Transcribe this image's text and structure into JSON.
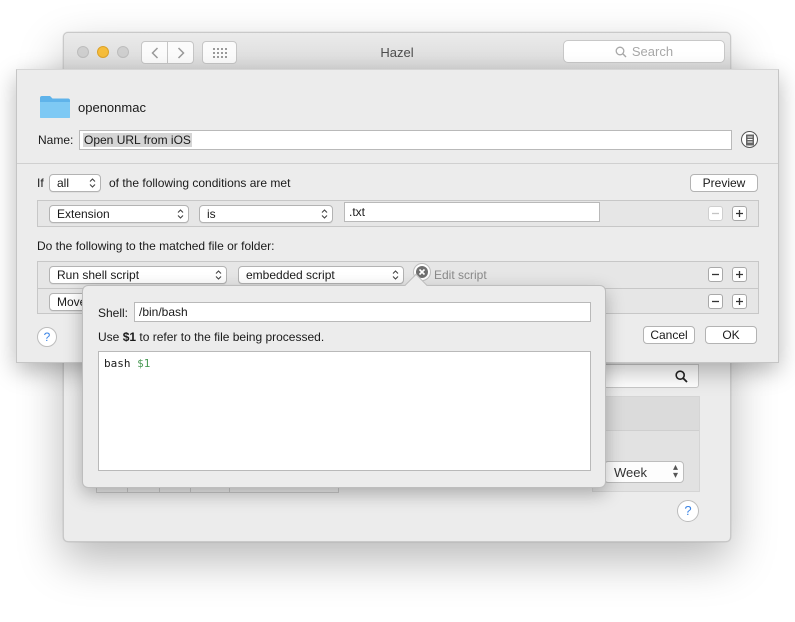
{
  "window": {
    "title": "Hazel",
    "search_placeholder": "Search",
    "week_select": "Week",
    "help": "?"
  },
  "sheet": {
    "folder_name": "openonmac",
    "name_label": "Name:",
    "name_value": "Open URL from iOS",
    "conditions": {
      "if_label": "If",
      "match_select": "all",
      "suffix": "of the following conditions are met",
      "preview_button": "Preview",
      "rule": {
        "attribute": "Extension",
        "operator": "is",
        "value": ".txt"
      }
    },
    "actions": {
      "heading": "Do the following to the matched file or folder:",
      "items": [
        {
          "action": "Run shell script",
          "option": "embedded script",
          "edit_link": "Edit script"
        },
        {
          "action": "Move"
        }
      ]
    },
    "help": "?",
    "cancel_button": "Cancel",
    "ok_button": "OK"
  },
  "popover": {
    "shell_label": "Shell:",
    "shell_value": "/bin/bash",
    "hint_prefix": "Use ",
    "hint_var": "$1",
    "hint_suffix": " to refer to the file being processed.",
    "script_cmd": "bash",
    "script_arg": "$1"
  },
  "colors": {
    "accent": "#3b84e5",
    "script_variable": "#4a9a55",
    "minimize_light": "#f6bd3b"
  }
}
